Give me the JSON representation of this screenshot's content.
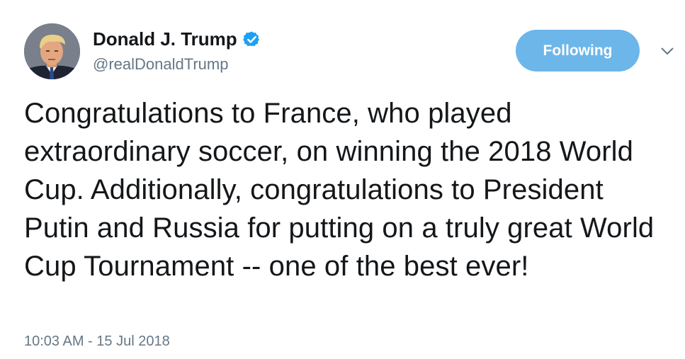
{
  "user": {
    "display_name": "Donald J. Trump",
    "handle": "@realDonaldTrump",
    "verified": true,
    "verified_icon": "verified-badge-icon",
    "avatar_icon": "profile-avatar"
  },
  "actions": {
    "follow_label": "Following",
    "menu_icon": "chevron-down-icon"
  },
  "tweet": {
    "text": "Congratulations to France, who played extraordinary soccer, on winning the 2018 World Cup. Additionally, congratulations to President Putin and Russia for putting on a truly great World Cup Tournament -- one of the best ever!",
    "timestamp": "10:03 AM - 15 Jul 2018"
  },
  "colors": {
    "text_primary": "#14171a",
    "text_secondary": "#657786",
    "follow_button_bg": "#6cb6ea",
    "verified_blue": "#1da1f2"
  }
}
